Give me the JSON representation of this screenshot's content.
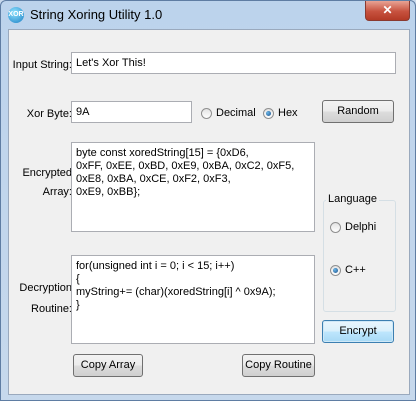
{
  "window": {
    "title": "String Xoring Utility 1.0",
    "close_label": "✕"
  },
  "input": {
    "label": "Input String:",
    "value": "Let's Xor This!"
  },
  "xor": {
    "label": "Xor Byte:",
    "value": "9A",
    "decimal_label": "Decimal",
    "hex_label": "Hex",
    "selected": "Hex",
    "random_label": "Random"
  },
  "encrypted": {
    "label_line1": "Encrypted",
    "label_line2": "Array:",
    "text": "byte const xoredString[15] = {0xD6,\n0xFF, 0xEE, 0xBD, 0xE9, 0xBA, 0xC2, 0xF5,\n0xE8, 0xBA, 0xCE, 0xF2, 0xF3,\n0xE9, 0xBB};"
  },
  "language": {
    "group_label": "Language",
    "options": [
      "Delphi",
      "C++"
    ],
    "selected": "C++"
  },
  "decryption": {
    "label_line1": "Decryption",
    "label_line2": "Routine:",
    "text": "for(unsigned int i = 0; i < 15; i++)\n{\nmyString+= (char)(xoredString[i] ^ 0x9A);\n}"
  },
  "buttons": {
    "encrypt_label": "Encrypt",
    "copy_array_label": "Copy Array",
    "copy_routine_label": "Copy Routine"
  }
}
